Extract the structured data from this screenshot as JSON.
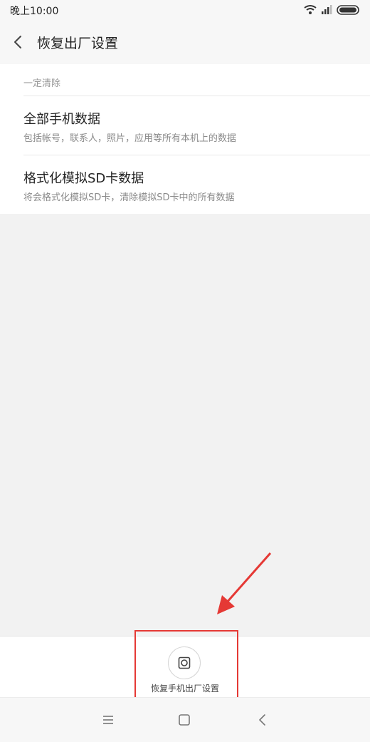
{
  "status_bar": {
    "time": "晚上10:00",
    "icons": [
      "wifi-icon",
      "signal-icon",
      "battery-icon"
    ]
  },
  "header": {
    "back_icon": "chevron-left-icon",
    "title": "恢复出厂设置"
  },
  "section": {
    "header": "一定清除",
    "options": [
      {
        "title": "全部手机数据",
        "description": "包括帐号，联系人，照片，应用等所有本机上的数据"
      },
      {
        "title": "格式化模拟SD卡数据",
        "description": "将会格式化模拟SD卡，清除模拟SD卡中的所有数据"
      }
    ]
  },
  "bottom_action": {
    "label": "恢复手机出厂设置",
    "icon": "reset-icon"
  },
  "annotation": {
    "color": "#e53935"
  },
  "nav_bar": {
    "icons": [
      "menu-icon",
      "home-icon",
      "back-icon"
    ]
  },
  "colors": {
    "background": "#f7f7f7",
    "card": "#ffffff",
    "text_primary": "#222222",
    "text_secondary": "#8a8a8a"
  }
}
